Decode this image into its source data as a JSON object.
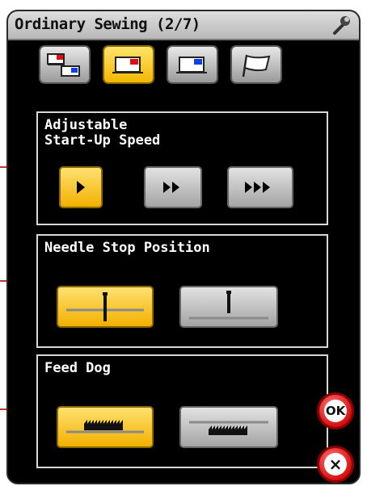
{
  "header": {
    "title": "Ordinary Sewing (2/7)",
    "settings_icon": "wrench-icon"
  },
  "toolbar": {
    "buttons": [
      {
        "name": "two-machines-icon",
        "active": false
      },
      {
        "name": "machine-red-icon",
        "active": true
      },
      {
        "name": "machine-blue-icon",
        "active": false
      },
      {
        "name": "flag-icon",
        "active": false
      }
    ]
  },
  "panels": {
    "speed": {
      "label": "Adjustable\nStart-Up Speed",
      "options": [
        {
          "name": "speed-slow",
          "icon": "play-single-icon",
          "active": true
        },
        {
          "name": "speed-medium",
          "icon": "play-double-icon",
          "active": false
        },
        {
          "name": "speed-fast",
          "icon": "play-triple-icon",
          "active": false
        }
      ]
    },
    "needle": {
      "label": "Needle Stop Position",
      "options": [
        {
          "name": "needle-down",
          "icon": "needle-down-icon",
          "active": true
        },
        {
          "name": "needle-up",
          "icon": "needle-up-icon",
          "active": false
        }
      ]
    },
    "feed": {
      "label": "Feed Dog",
      "options": [
        {
          "name": "feed-dog-up",
          "icon": "feed-dog-up-icon",
          "active": true
        },
        {
          "name": "feed-dog-down",
          "icon": "feed-dog-down-icon",
          "active": false
        }
      ]
    }
  },
  "actions": {
    "ok_label": "OK",
    "close_label": "×"
  },
  "colors": {
    "active": "#f5be00",
    "inactive": "#b0b0b0",
    "panel_border": "#d8d8d8",
    "accent_red": "#d81010"
  }
}
